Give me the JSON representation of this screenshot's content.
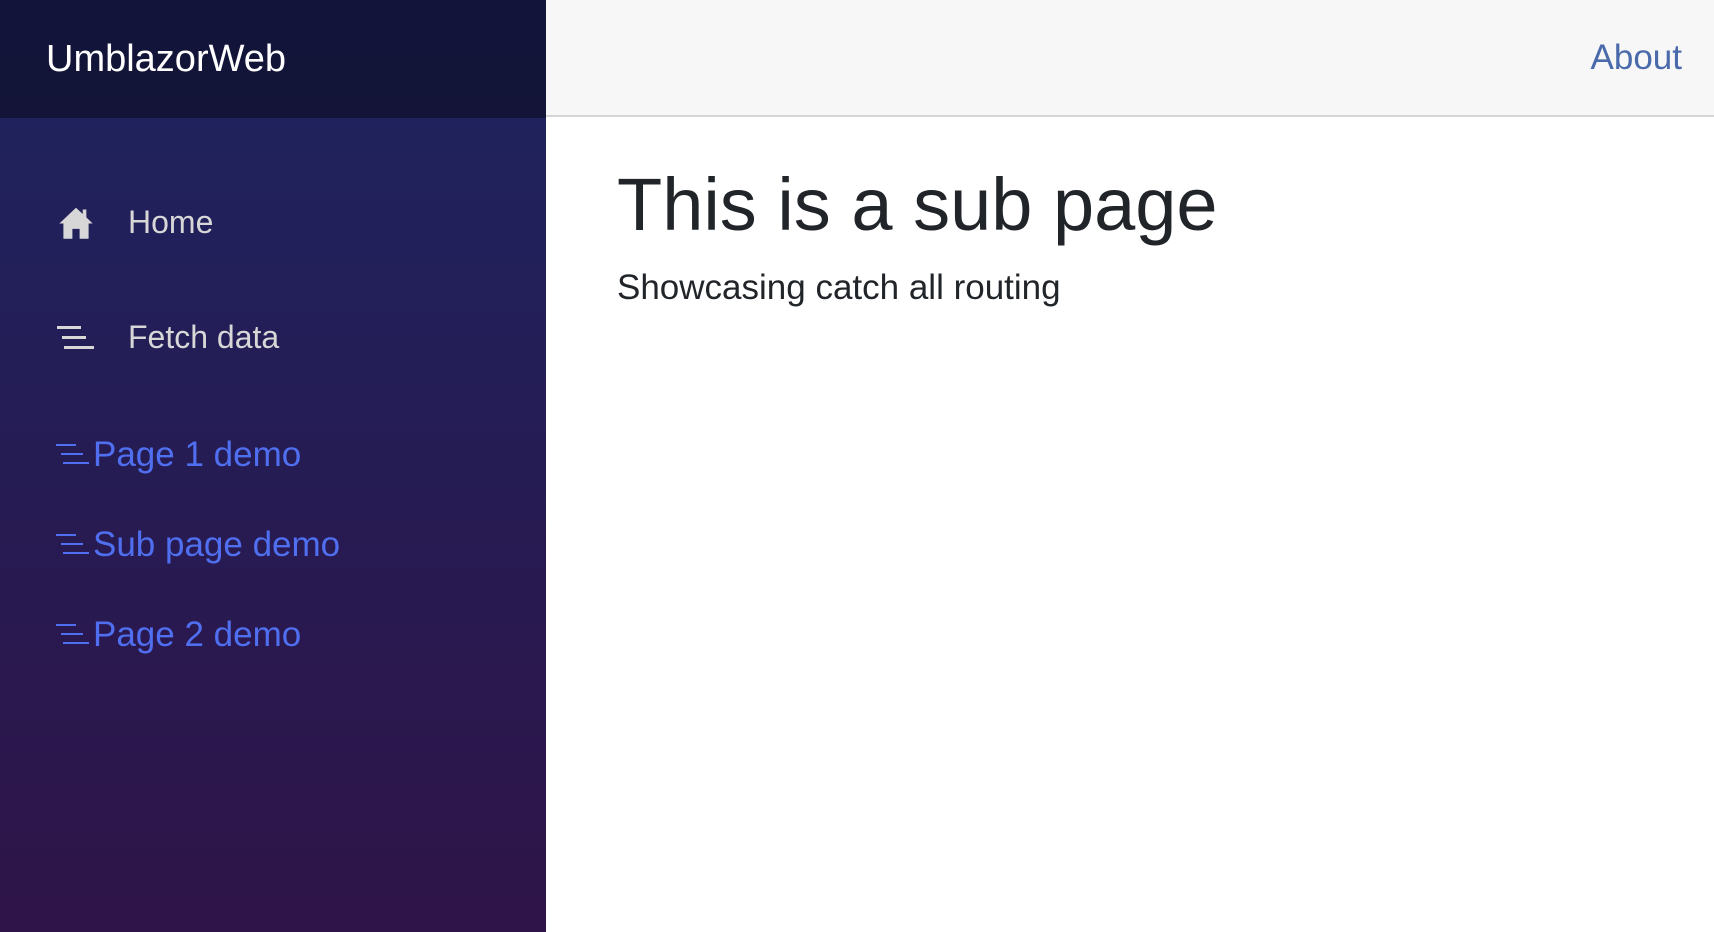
{
  "app": {
    "brand": "UmblazorWeb"
  },
  "sidebar": {
    "items": [
      {
        "label": "Home",
        "icon": "home-icon"
      },
      {
        "label": "Fetch data",
        "icon": "list-icon"
      }
    ],
    "subitems": [
      {
        "label": "Page 1 demo",
        "icon": "list-icon"
      },
      {
        "label": "Sub page demo",
        "icon": "list-icon"
      },
      {
        "label": "Page 2 demo",
        "icon": "list-icon"
      }
    ]
  },
  "header": {
    "about_label": "About"
  },
  "main": {
    "title": "This is a sub page",
    "subtitle": "Showcasing catch all routing"
  },
  "colors": {
    "sidebar_top": "#1e2460",
    "sidebar_bottom": "#2e1448",
    "brand_bar": "#11173a",
    "nav_text": "#d7d7d7",
    "sub_link": "#4f6ff0",
    "about_link": "#4a6aab",
    "top_row_bg": "#f7f7f7",
    "heading_text": "#212529"
  }
}
